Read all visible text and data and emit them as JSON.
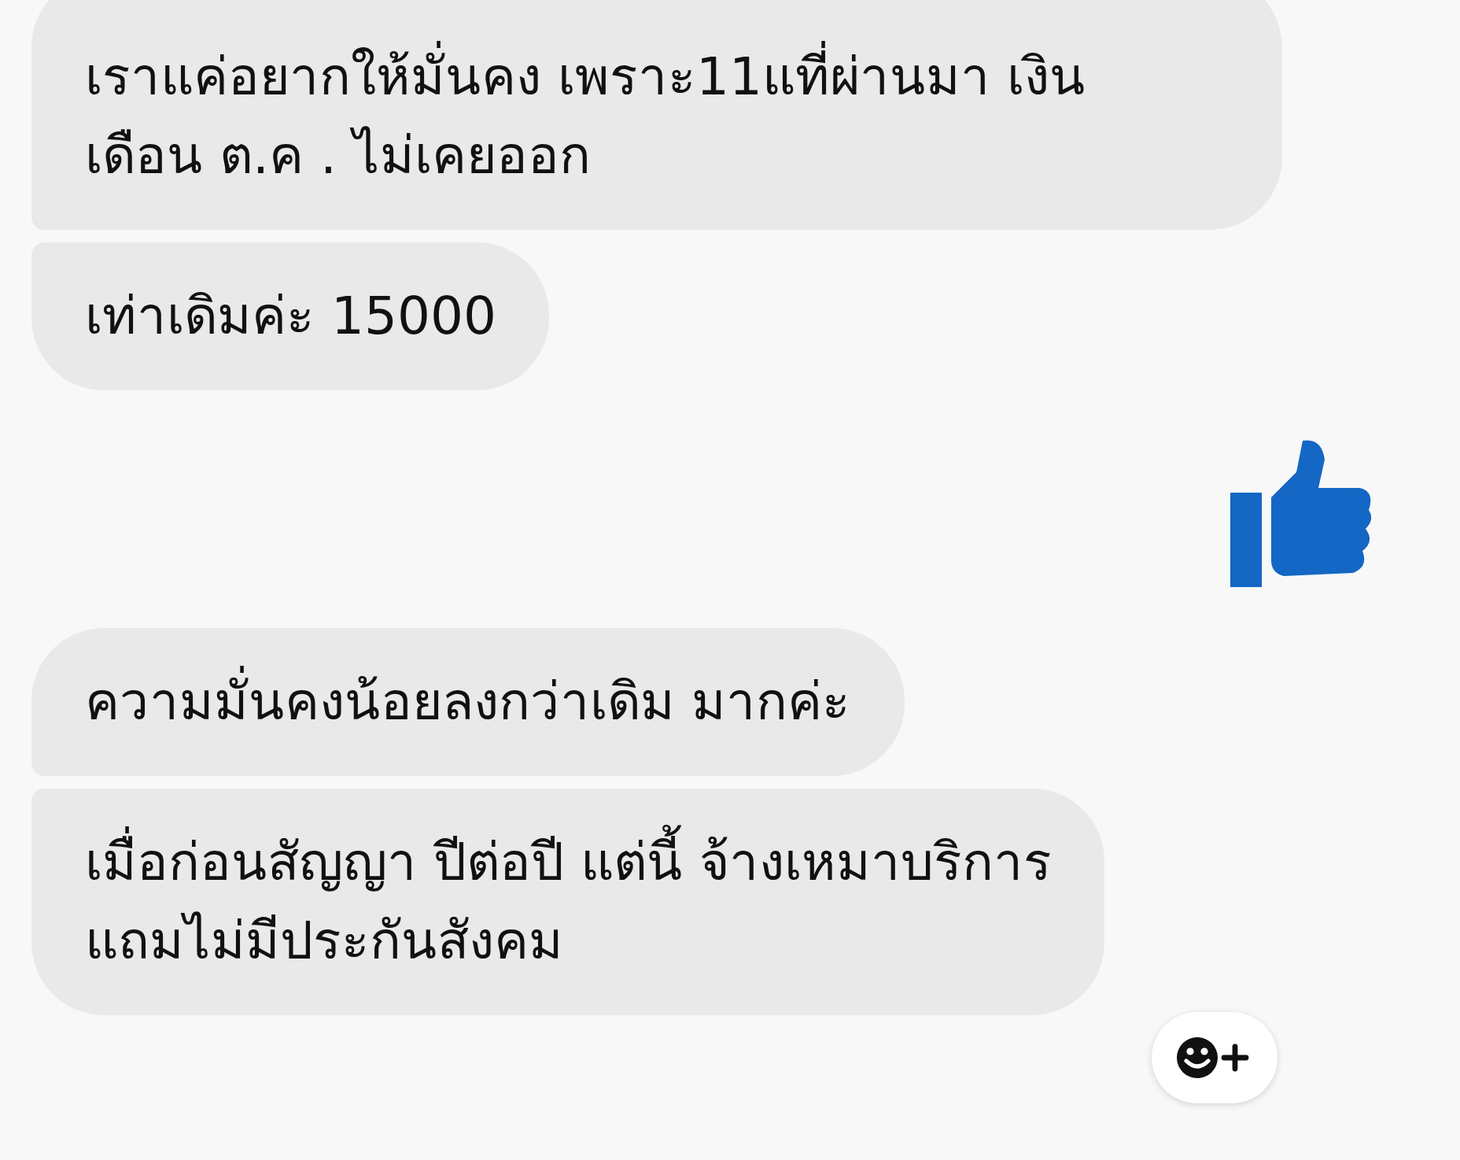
{
  "messages": [
    {
      "kind": "text",
      "lines": [
        "เราแค่อยากให้มั่นคง เพราะ11แที่ผ่านมา เงิน",
        "เดือน ต.ค . ไม่เคยออก"
      ]
    },
    {
      "kind": "text",
      "lines": [
        "เท่าเดิมค่ะ 15000"
      ]
    },
    {
      "kind": "like"
    },
    {
      "kind": "text",
      "lines": [
        "ความมั่นคงน้อยลงกว่าเดิม มากค่ะ"
      ]
    },
    {
      "kind": "text",
      "lines": [
        "เมื่อก่อนสัญญา ปีต่อปี แต่นี้ จ้างเหมาบริการ",
        "แถมไม่มีประกันสังคม"
      ]
    }
  ]
}
